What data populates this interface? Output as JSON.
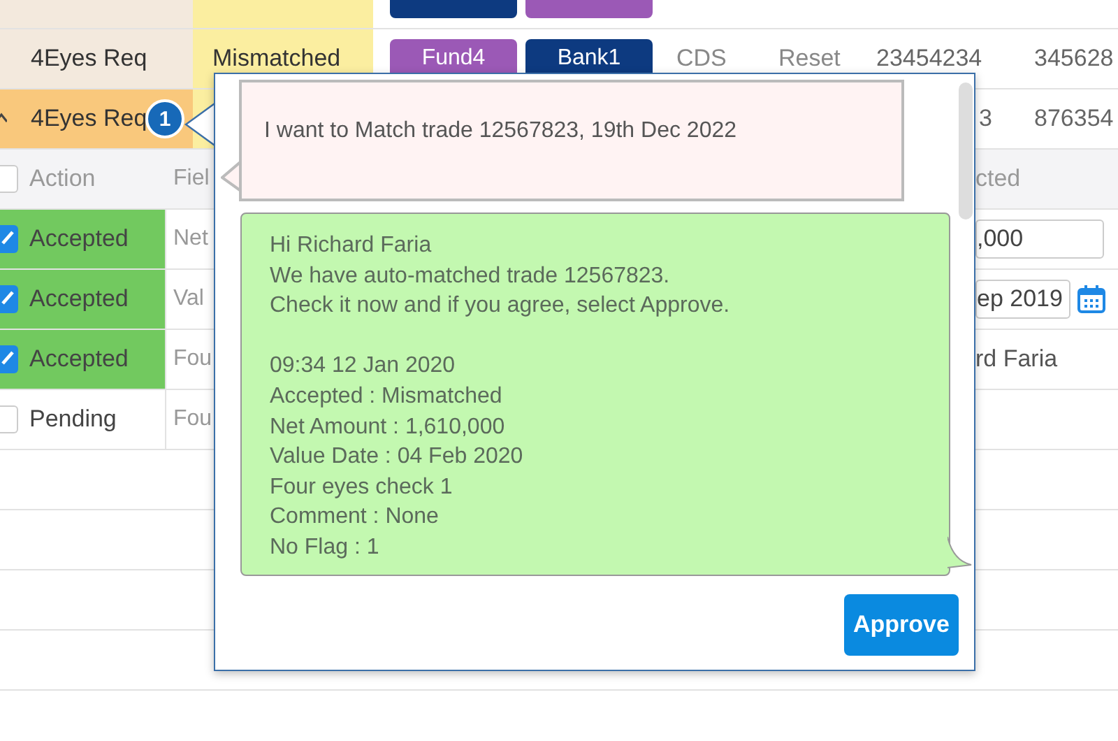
{
  "trades": [
    {
      "chips": [
        {
          "kind": "bank"
        },
        {
          "kind": "fund"
        }
      ],
      "selected": false,
      "expanded": false
    },
    {
      "status": "4Eyes Req",
      "match": "Mismatched",
      "chips": [
        {
          "label": "Fund4",
          "kind": "fund"
        },
        {
          "label": "Bank1",
          "kind": "bank"
        }
      ],
      "product": "CDS",
      "event": "Reset",
      "id": "23454234",
      "ref": "345628",
      "selected": false,
      "expanded": false
    },
    {
      "status": "4Eyes Req",
      "badge": "1",
      "id": "3",
      "ref": "876354",
      "selected": true,
      "expanded": true
    }
  ],
  "details": {
    "header": {
      "checked": false,
      "action": "Action",
      "field": "Fiel",
      "right": "cted"
    },
    "rows": [
      {
        "checked": true,
        "action": "Accepted",
        "field": "Net",
        "right": {
          "kind": "input",
          "value": ",000"
        }
      },
      {
        "checked": true,
        "action": "Accepted",
        "field": "Val",
        "right": {
          "kind": "date",
          "value": "ep 2019"
        }
      },
      {
        "checked": true,
        "action": "Accepted",
        "field": "Fou",
        "right": {
          "kind": "text",
          "value": "rd Faria"
        }
      },
      {
        "checked": false,
        "action": "Pending",
        "field": "Fou"
      }
    ]
  },
  "popover": {
    "request": "I want to Match trade 12567823, 19th Dec 2022",
    "reply": [
      [
        "Hi Richard Faria",
        "We have auto-matched trade 12567823.",
        "Check it now and if you agree, select Approve."
      ],
      [
        "09:34 12 Jan 2020",
        "Accepted : Mismatched",
        "Net Amount : 1,610,000",
        "Value Date : 04 Feb 2020",
        "Four eyes check 1",
        "Comment : None",
        "No Flag : 1"
      ]
    ],
    "button": "Approve"
  }
}
